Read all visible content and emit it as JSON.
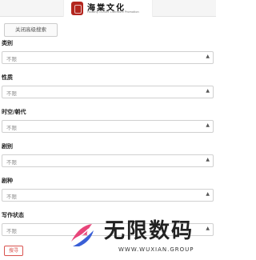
{
  "header": {
    "logo_title": "海棠文化",
    "logo_subtitle": "Haitang Culture Literature Promotion"
  },
  "close_advanced_label": "关闭高级搜索",
  "fields": [
    {
      "label": "类别",
      "value": "不限"
    },
    {
      "label": "性质",
      "value": "不限"
    },
    {
      "label": "时空/朝代",
      "value": "不限"
    },
    {
      "label": "剧别",
      "value": "不限"
    },
    {
      "label": "剧种",
      "value": "不限"
    },
    {
      "label": "写作状态",
      "value": "不限"
    }
  ],
  "search_button_label": "搜寻",
  "watermark": {
    "text": "无限数码",
    "url": "WWW.WUXIAN.GROUP"
  },
  "colors": {
    "logo_seal": "#b3261e",
    "search_border": "#d9534f",
    "watermark_pink": "#e8457a",
    "watermark_blue": "#3a5fd6"
  }
}
